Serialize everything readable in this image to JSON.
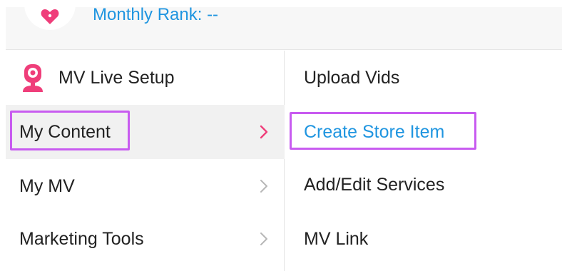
{
  "header": {
    "monthly_rank_label": "Monthly Rank: --"
  },
  "left_menu": {
    "items": [
      {
        "label": "MV Live Setup",
        "icon": "webcam-icon"
      },
      {
        "label": "My Content",
        "active": true,
        "chevron": "chevron-right-icon"
      },
      {
        "label": "My MV",
        "chevron": "chevron-right-icon"
      },
      {
        "label": "Marketing Tools",
        "chevron": "chevron-right-icon"
      }
    ]
  },
  "sub_menu": {
    "items": [
      {
        "label": "Upload Vids"
      },
      {
        "label": "Create Store Item",
        "highlighted": true
      },
      {
        "label": "Add/Edit Services"
      },
      {
        "label": "MV Link"
      }
    ]
  },
  "colors": {
    "accent_blue": "#1f95e0",
    "brand_pink": "#ef3e7a",
    "highlight_purple": "#c85bf0",
    "chevron_gray": "#b7b7b7"
  }
}
